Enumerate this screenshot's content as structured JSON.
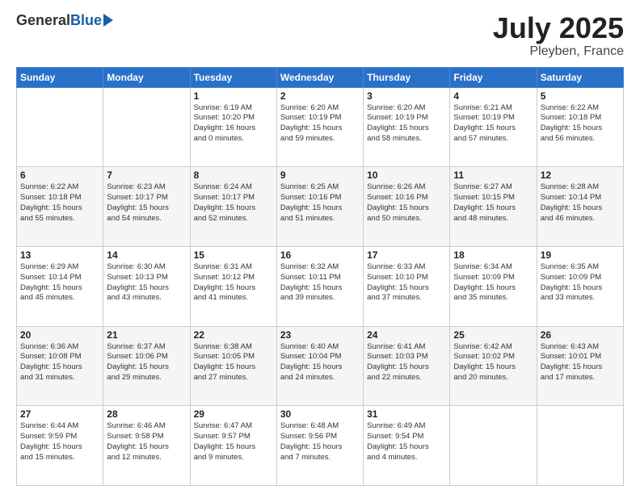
{
  "logo": {
    "general": "General",
    "blue": "Blue"
  },
  "title": "July 2025",
  "location": "Pleyben, France",
  "days_header": [
    "Sunday",
    "Monday",
    "Tuesday",
    "Wednesday",
    "Thursday",
    "Friday",
    "Saturday"
  ],
  "weeks": [
    [
      {
        "day": "",
        "text": ""
      },
      {
        "day": "",
        "text": ""
      },
      {
        "day": "1",
        "text": "Sunrise: 6:19 AM\nSunset: 10:20 PM\nDaylight: 16 hours\nand 0 minutes."
      },
      {
        "day": "2",
        "text": "Sunrise: 6:20 AM\nSunset: 10:19 PM\nDaylight: 15 hours\nand 59 minutes."
      },
      {
        "day": "3",
        "text": "Sunrise: 6:20 AM\nSunset: 10:19 PM\nDaylight: 15 hours\nand 58 minutes."
      },
      {
        "day": "4",
        "text": "Sunrise: 6:21 AM\nSunset: 10:19 PM\nDaylight: 15 hours\nand 57 minutes."
      },
      {
        "day": "5",
        "text": "Sunrise: 6:22 AM\nSunset: 10:18 PM\nDaylight: 15 hours\nand 56 minutes."
      }
    ],
    [
      {
        "day": "6",
        "text": "Sunrise: 6:22 AM\nSunset: 10:18 PM\nDaylight: 15 hours\nand 55 minutes."
      },
      {
        "day": "7",
        "text": "Sunrise: 6:23 AM\nSunset: 10:17 PM\nDaylight: 15 hours\nand 54 minutes."
      },
      {
        "day": "8",
        "text": "Sunrise: 6:24 AM\nSunset: 10:17 PM\nDaylight: 15 hours\nand 52 minutes."
      },
      {
        "day": "9",
        "text": "Sunrise: 6:25 AM\nSunset: 10:16 PM\nDaylight: 15 hours\nand 51 minutes."
      },
      {
        "day": "10",
        "text": "Sunrise: 6:26 AM\nSunset: 10:16 PM\nDaylight: 15 hours\nand 50 minutes."
      },
      {
        "day": "11",
        "text": "Sunrise: 6:27 AM\nSunset: 10:15 PM\nDaylight: 15 hours\nand 48 minutes."
      },
      {
        "day": "12",
        "text": "Sunrise: 6:28 AM\nSunset: 10:14 PM\nDaylight: 15 hours\nand 46 minutes."
      }
    ],
    [
      {
        "day": "13",
        "text": "Sunrise: 6:29 AM\nSunset: 10:14 PM\nDaylight: 15 hours\nand 45 minutes."
      },
      {
        "day": "14",
        "text": "Sunrise: 6:30 AM\nSunset: 10:13 PM\nDaylight: 15 hours\nand 43 minutes."
      },
      {
        "day": "15",
        "text": "Sunrise: 6:31 AM\nSunset: 10:12 PM\nDaylight: 15 hours\nand 41 minutes."
      },
      {
        "day": "16",
        "text": "Sunrise: 6:32 AM\nSunset: 10:11 PM\nDaylight: 15 hours\nand 39 minutes."
      },
      {
        "day": "17",
        "text": "Sunrise: 6:33 AM\nSunset: 10:10 PM\nDaylight: 15 hours\nand 37 minutes."
      },
      {
        "day": "18",
        "text": "Sunrise: 6:34 AM\nSunset: 10:09 PM\nDaylight: 15 hours\nand 35 minutes."
      },
      {
        "day": "19",
        "text": "Sunrise: 6:35 AM\nSunset: 10:09 PM\nDaylight: 15 hours\nand 33 minutes."
      }
    ],
    [
      {
        "day": "20",
        "text": "Sunrise: 6:36 AM\nSunset: 10:08 PM\nDaylight: 15 hours\nand 31 minutes."
      },
      {
        "day": "21",
        "text": "Sunrise: 6:37 AM\nSunset: 10:06 PM\nDaylight: 15 hours\nand 29 minutes."
      },
      {
        "day": "22",
        "text": "Sunrise: 6:38 AM\nSunset: 10:05 PM\nDaylight: 15 hours\nand 27 minutes."
      },
      {
        "day": "23",
        "text": "Sunrise: 6:40 AM\nSunset: 10:04 PM\nDaylight: 15 hours\nand 24 minutes."
      },
      {
        "day": "24",
        "text": "Sunrise: 6:41 AM\nSunset: 10:03 PM\nDaylight: 15 hours\nand 22 minutes."
      },
      {
        "day": "25",
        "text": "Sunrise: 6:42 AM\nSunset: 10:02 PM\nDaylight: 15 hours\nand 20 minutes."
      },
      {
        "day": "26",
        "text": "Sunrise: 6:43 AM\nSunset: 10:01 PM\nDaylight: 15 hours\nand 17 minutes."
      }
    ],
    [
      {
        "day": "27",
        "text": "Sunrise: 6:44 AM\nSunset: 9:59 PM\nDaylight: 15 hours\nand 15 minutes."
      },
      {
        "day": "28",
        "text": "Sunrise: 6:46 AM\nSunset: 9:58 PM\nDaylight: 15 hours\nand 12 minutes."
      },
      {
        "day": "29",
        "text": "Sunrise: 6:47 AM\nSunset: 9:57 PM\nDaylight: 15 hours\nand 9 minutes."
      },
      {
        "day": "30",
        "text": "Sunrise: 6:48 AM\nSunset: 9:56 PM\nDaylight: 15 hours\nand 7 minutes."
      },
      {
        "day": "31",
        "text": "Sunrise: 6:49 AM\nSunset: 9:54 PM\nDaylight: 15 hours\nand 4 minutes."
      },
      {
        "day": "",
        "text": ""
      },
      {
        "day": "",
        "text": ""
      }
    ]
  ]
}
